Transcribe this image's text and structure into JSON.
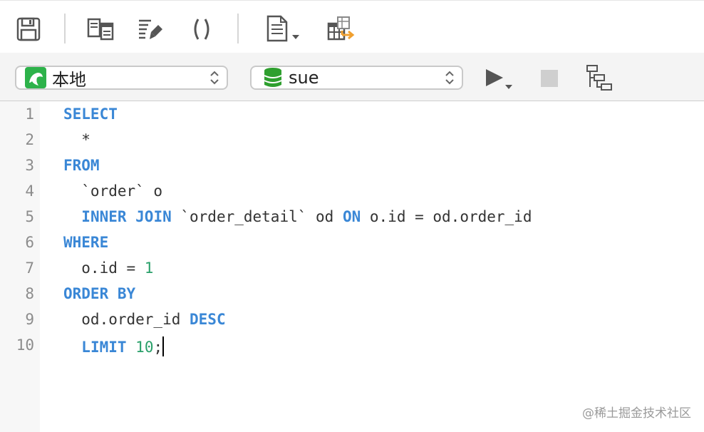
{
  "toolbar": {
    "buttons": [
      {
        "name": "save-icon"
      },
      {
        "name": "object-browser-icon"
      },
      {
        "name": "beautify-sql-icon"
      },
      {
        "name": "code-snippet-icon"
      },
      {
        "name": "text-file-menu-icon"
      },
      {
        "name": "export-result-icon"
      }
    ]
  },
  "connection": {
    "label": "本地",
    "icon": "mysql-dolphin-icon",
    "icon_color": "#2db24a"
  },
  "database": {
    "label": "sue",
    "icon": "database-icon",
    "icon_color": "#2e9f2e"
  },
  "actions": {
    "run": "run-icon",
    "stop": "stop-icon",
    "explain": "explain-icon"
  },
  "editor": {
    "line_numbers": [
      "1",
      "2",
      "3",
      "4",
      "5",
      "6",
      "7",
      "8",
      "9",
      "10"
    ],
    "lines": [
      [
        {
          "t": "SELECT",
          "c": "kw"
        }
      ],
      [
        {
          "t": "  *",
          "c": ""
        }
      ],
      [
        {
          "t": "FROM",
          "c": "kw"
        }
      ],
      [
        {
          "t": "  `order` o",
          "c": ""
        }
      ],
      [
        {
          "t": "  ",
          "c": ""
        },
        {
          "t": "INNER JOIN",
          "c": "kw"
        },
        {
          "t": " `order_detail` od ",
          "c": ""
        },
        {
          "t": "ON",
          "c": "kw"
        },
        {
          "t": " o.id = od.order_id",
          "c": ""
        }
      ],
      [
        {
          "t": "WHERE",
          "c": "kw"
        }
      ],
      [
        {
          "t": "  o.id = ",
          "c": ""
        },
        {
          "t": "1",
          "c": "num"
        }
      ],
      [
        {
          "t": "ORDER BY",
          "c": "kw"
        }
      ],
      [
        {
          "t": "  od.order_id ",
          "c": ""
        },
        {
          "t": "DESC",
          "c": "kw"
        }
      ],
      [
        {
          "t": "  ",
          "c": ""
        },
        {
          "t": "LIMIT",
          "c": "kw"
        },
        {
          "t": " ",
          "c": ""
        },
        {
          "t": "10",
          "c": "num"
        },
        {
          "t": ";",
          "c": ""
        }
      ]
    ]
  },
  "watermark": "@稀土掘金技术社区",
  "colors": {
    "keyword": "#3a87d6",
    "number": "#2aa06a",
    "accent_orange": "#f0a030"
  }
}
